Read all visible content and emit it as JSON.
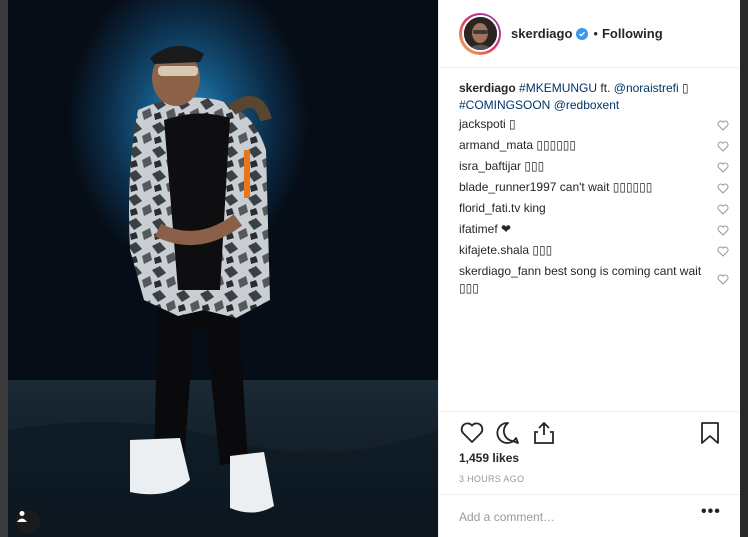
{
  "header": {
    "username": "skerdiago",
    "separator": "•",
    "follow_status": "Following"
  },
  "caption": {
    "username": "skerdiago",
    "hashtag1": "#MKEMUNGU",
    "text1": "ft.",
    "mention1": "@noraistrefi",
    "glyph": "▯",
    "hashtag2": "#COMINGSOON",
    "mention2": "@redboxent"
  },
  "comments": [
    {
      "user": "jackspoti",
      "text": "▯"
    },
    {
      "user": "armand_mata",
      "text": "▯▯▯▯▯▯"
    },
    {
      "user": "isra_baftijar",
      "text": "▯▯▯"
    },
    {
      "user": "blade_runner1997",
      "text": "can't wait ▯▯▯▯▯▯"
    },
    {
      "user": "florid_fati.tv",
      "text": "king"
    },
    {
      "user": "ifatimef",
      "text": "❤"
    },
    {
      "user": "kifajete.shala",
      "text": "▯▯▯"
    },
    {
      "user": "skerdiago_fann",
      "text": "best song is coming cant wait ▯▯▯"
    }
  ],
  "likes": "1,459 likes",
  "time": "3 HOURS AGO",
  "comment_placeholder": "Add a comment…",
  "more_label": "•••",
  "icons": [
    "heart-icon",
    "comment-icon",
    "share-icon",
    "bookmark-icon",
    "verified-icon",
    "user-tag-icon"
  ],
  "colors": {
    "link": "#003569",
    "verified": "#3897f0",
    "text": "#262626",
    "muted": "#999999"
  }
}
